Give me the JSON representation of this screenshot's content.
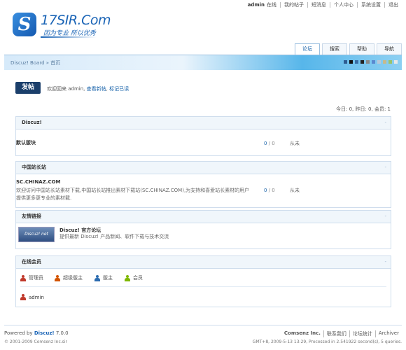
{
  "topbar": {
    "user": "admin",
    "items": [
      "在线",
      "我的帖子",
      "短消息",
      "个人中心",
      "系统设置",
      "退出"
    ]
  },
  "logo": {
    "brand": "17SIR.Com",
    "slogan": "因为专业  所以优秀",
    "badge": "S"
  },
  "navtabs": [
    "论坛",
    "搜索",
    "帮助",
    "导航"
  ],
  "breadcrumb": "Discuz! Board » 首页",
  "swatch_colors": [
    "#2d5d93",
    "#111111",
    "#3a6ea5",
    "#222222",
    "#8a8a8a",
    "#5a8ad0",
    "#b9c8d8",
    "#c7b98b",
    "#9ac36a",
    "#e8e8e8"
  ],
  "toolbar": {
    "post_label": "发帖",
    "welcome_text": "欢迎回来  admin,",
    "new_posts_link": "查看新帖",
    "mark_read_link": "标记已读"
  },
  "stats": "今日: 0, 昨日: 0, 会员: 1",
  "sections": [
    {
      "title": "Discuz!",
      "collapse": "-",
      "forums": [
        {
          "name": "默认版块",
          "desc": "",
          "threads": "0",
          "posts": "0",
          "last": "从未"
        }
      ]
    },
    {
      "title": "中国站长站",
      "collapse": "-",
      "forums": [
        {
          "name": "SC.CHINAZ.COM",
          "desc1": "欢迎访问中国站长站素材下载,中国站长站推出素材下载站(SC.CHINAZ.COM),为支持和喜爱站长素材的用户",
          "desc2": "提供更多更专业的素材载.",
          "threads": "0",
          "posts": "0",
          "last": "从未"
        }
      ]
    }
  ],
  "links_section": {
    "title": "友情链接",
    "collapse": "-",
    "logo_text": "Discuz! net",
    "name": "Discuz! 官方论坛",
    "desc": "提供最新 Discuz! 产品新闻、软件下载与技术交流"
  },
  "online_section": {
    "title": "在线会员",
    "collapse": "-",
    "legend": [
      {
        "label": "管理员",
        "color": "#c0392b"
      },
      {
        "label": "超级版主",
        "color": "#d35400"
      },
      {
        "label": "版主",
        "color": "#2c6cb0"
      },
      {
        "label": "会员",
        "color": "#7fb800"
      }
    ],
    "members": [
      "admin"
    ]
  },
  "footer": {
    "powered_prefix": "Powered by",
    "powered_name": "Discuz!",
    "powered_version": "7.0.0",
    "copyright": "© 2001-2009 Comsenz Inc.sir",
    "links": [
      "Comsenz Inc.",
      "联系我们",
      "论坛统计",
      "Archiver"
    ],
    "processed": "GMT+8, 2009-5-13 13:29, Processed in 2.541922 second(s), 5 queries."
  }
}
